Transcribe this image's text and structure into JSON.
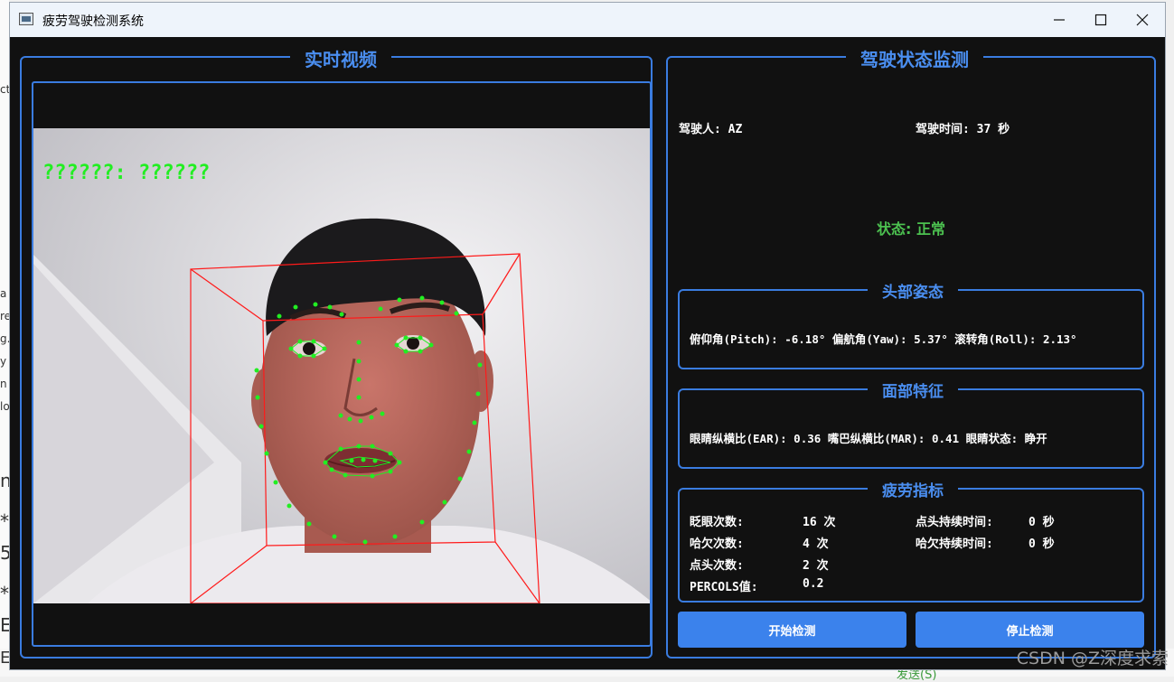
{
  "window": {
    "title": "疲劳驾驶检测系统"
  },
  "video_panel": {
    "title": "实时视频",
    "overlay_text": "??????: ??????"
  },
  "monitor_panel": {
    "title": "驾驶状态监测",
    "driver": "驾驶人: AZ",
    "drive_time": "驾驶时间: 37 秒",
    "status": "状态: 正常"
  },
  "head_pose": {
    "title": "头部姿态",
    "text": "俯仰角(Pitch): -6.18°  偏航角(Yaw): 5.37°  滚转角(Roll): 2.13°"
  },
  "face_features": {
    "title": "面部特征",
    "text": "眼睛纵横比(EAR): 0.36 嘴巴纵横比(MAR): 0.41 眼睛状态: 睁开"
  },
  "fatigue": {
    "title": "疲劳指标",
    "blink_label": "眨眼次数:",
    "blink_value": "16 次",
    "yawn_label": "哈欠次数:",
    "yawn_value": "4 次",
    "nod_label": "点头次数:",
    "nod_value": "2 次",
    "percols_label": "PERCOLS值:",
    "percols_value": "0.2",
    "nod_duration_label": "点头持续时间:",
    "nod_duration_value": "0 秒",
    "yawn_duration_label": "哈欠持续时间:",
    "yawn_duration_value": "0 秒"
  },
  "buttons": {
    "start": "开始检测",
    "stop": "停止检测"
  },
  "background": {
    "fragments": [
      "ct",
      "a",
      "re",
      "g.",
      "y",
      "n",
      "lo",
      "n",
      "*",
      "5",
      "*",
      "E",
      "E\\ 最子"
    ],
    "send": "发送(S)",
    "watermark": "CSDN @Z深度求索"
  },
  "colors": {
    "accent": "#3a7ce0",
    "status_ok": "#4cc150",
    "button": "#3b82ec",
    "overlay_green": "#22ee22",
    "box_red": "#ff1a1a"
  },
  "icons": [
    "app-icon",
    "minimize-icon",
    "maximize-icon",
    "close-icon",
    "face-landmarks",
    "head-pose-box"
  ]
}
